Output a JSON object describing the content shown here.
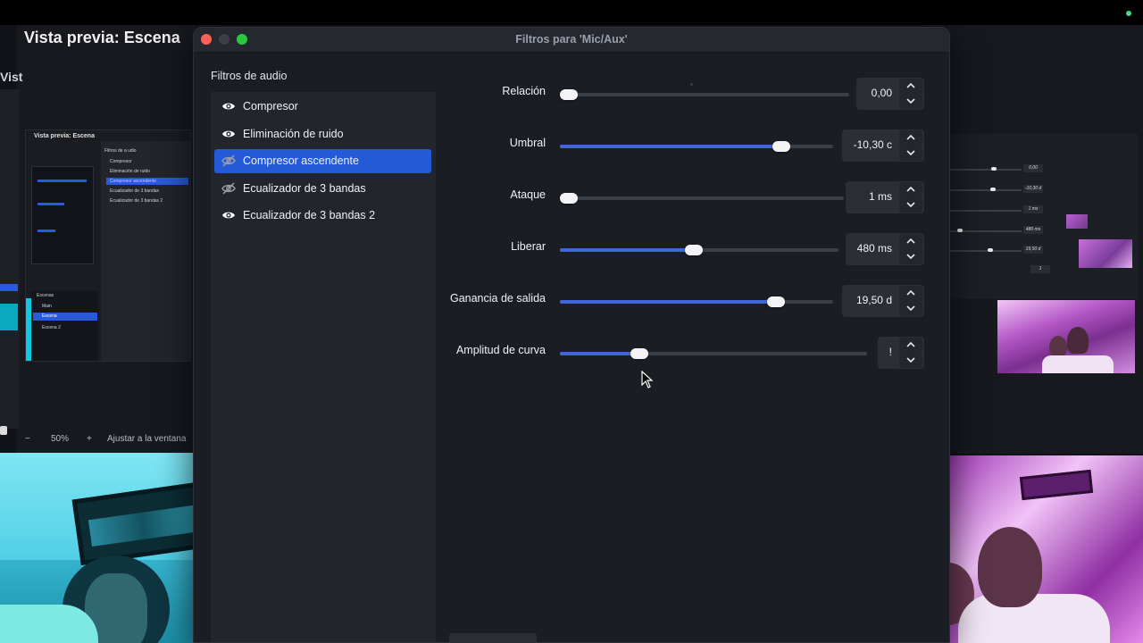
{
  "background": {
    "preview_title": "Vista previa: Escena",
    "left_cut_text": "Vist",
    "zoom_toolbar": {
      "minus": "−",
      "zoom": "50%",
      "plus": "+",
      "fit": "Ajustar a la ventana"
    },
    "nested": {
      "title": "Vista previa: Escena",
      "panel_header": "Filtros de a udio",
      "items": [
        "Compresor",
        "Eliminación de ruido",
        "Compresor ascendente",
        "Ecualizador de 3 bandas",
        "Ecualizador de 3 bandas 2"
      ],
      "scenes_header": "Escenas",
      "scenes": [
        "Main",
        "Escena",
        "Escena 2"
      ]
    },
    "right_values": [
      "0,00",
      "-10,30 d",
      "1 ms",
      "480 ms",
      "19,50 d",
      "1"
    ]
  },
  "dialog": {
    "title": "Filtros para 'Mic/Aux'",
    "section_label": "Filtros de audio",
    "filters": [
      {
        "label": "Compresor",
        "icon": "eye-icon",
        "enabled": true,
        "selected": false
      },
      {
        "label": "Eliminación de ruido",
        "icon": "eye-icon",
        "enabled": true,
        "selected": false
      },
      {
        "label": "Compresor ascendente",
        "icon": "eye-off-icon",
        "enabled": false,
        "selected": true
      },
      {
        "label": "Ecualizador de 3 bandas",
        "icon": "eye-off-icon",
        "enabled": false,
        "selected": false
      },
      {
        "label": "Ecualizador de 3 bandas 2",
        "icon": "eye-icon",
        "enabled": true,
        "selected": false
      }
    ],
    "settings": [
      {
        "label": "Relación",
        "value": "0,00",
        "fraction": 0.03
      },
      {
        "label": "Umbral",
        "value": "-10,30 c",
        "fraction": 0.81
      },
      {
        "label": "Ataque",
        "value": "1 ms",
        "fraction": 0.03
      },
      {
        "label": "Liberar",
        "value": "480 ms",
        "fraction": 0.48
      },
      {
        "label": "Ganancia de salida",
        "value": "19,50 d",
        "fraction": 0.79
      },
      {
        "label": "Amplitud de curva",
        "value": "!",
        "fraction": 0.26
      }
    ],
    "colors": {
      "accent": "#2459d8",
      "slider_fill": "#3f67d8"
    }
  }
}
